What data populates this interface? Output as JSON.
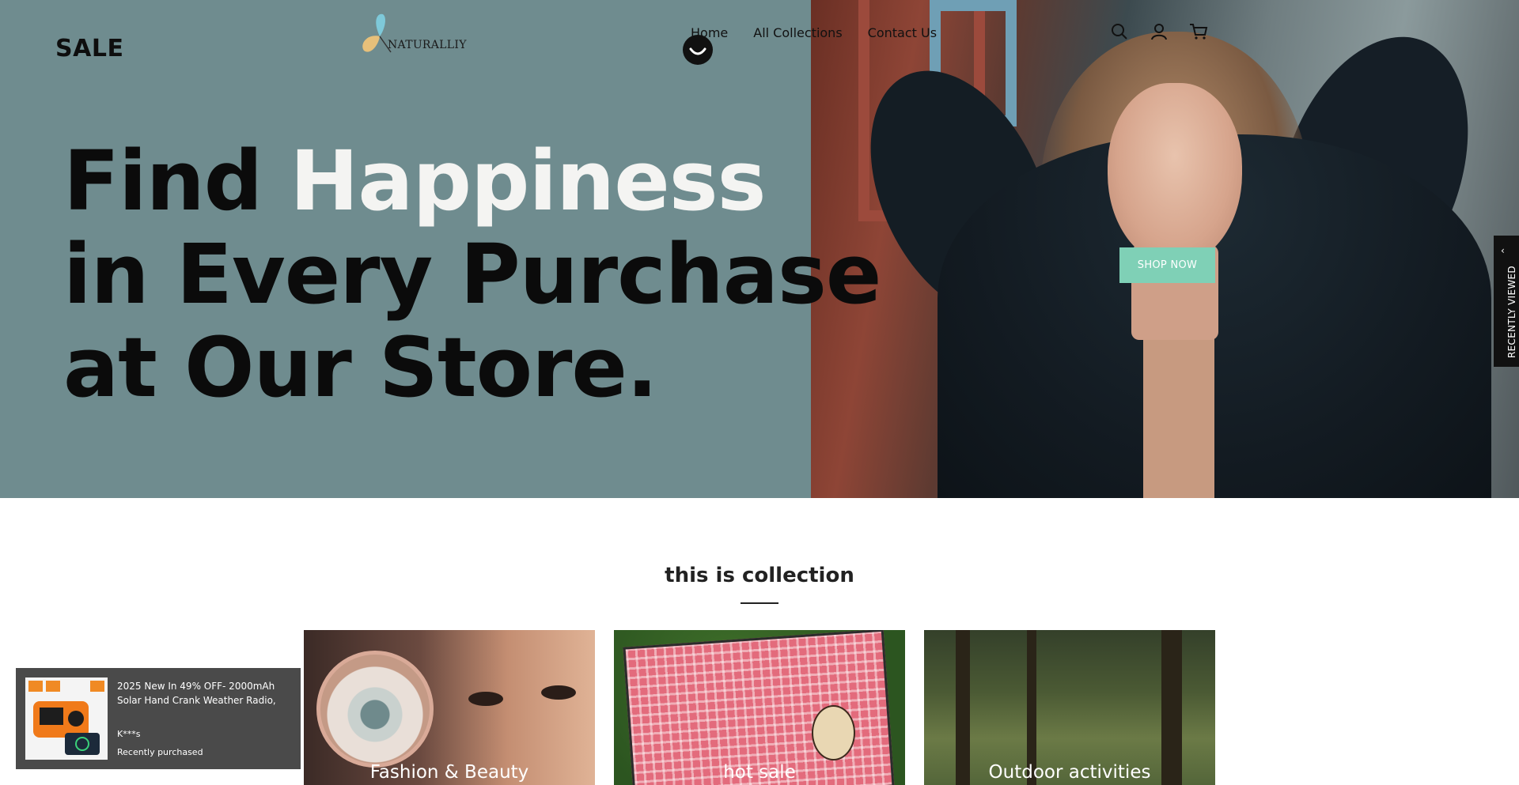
{
  "header": {
    "sale_logo": "SALE",
    "brand_name": "NATURALLIY",
    "nav": [
      "Home",
      "All Collections",
      "Contact Us"
    ],
    "icons": [
      "search-icon",
      "account-icon",
      "cart-icon"
    ]
  },
  "hero": {
    "line1_a": "Find ",
    "line1_b": "Happiness",
    "line2": "in Every Purchase",
    "line3": "at Our Store.",
    "cta": "SHOP NOW",
    "accent_color": "#7fd0b6",
    "background_color": "#6f8c8f"
  },
  "recently_viewed": {
    "label": "RECENTLY VIEWED",
    "icon": "chevron-left-icon"
  },
  "collection": {
    "title": "this is collection",
    "cards": [
      {
        "title": "Fashion & Beauty"
      },
      {
        "title": "hot sale"
      },
      {
        "title": "Outdoor activities"
      }
    ]
  },
  "toast": {
    "product": "2025 New In 49% OFF- 2000mAh Solar Hand Crank Weather Radio,",
    "user": "K***s",
    "status": "Recently purchased"
  }
}
